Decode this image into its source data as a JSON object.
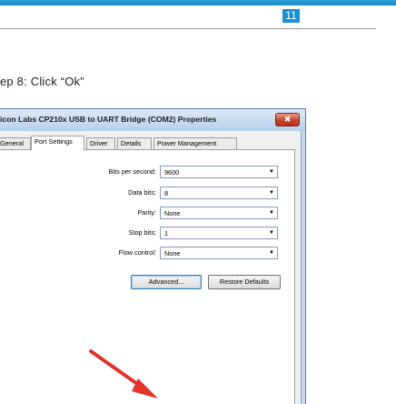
{
  "page": {
    "page_number": "11",
    "step_text": "ep 8: Click “Ok”"
  },
  "dialog": {
    "title": "icon Labs CP210x USB to UART Bridge (COM2) Properties",
    "close_glyph": "✖",
    "tabs": [
      {
        "label": "General",
        "active": false
      },
      {
        "label": "Port Settings",
        "active": true
      },
      {
        "label": "Driver",
        "active": false
      },
      {
        "label": "Details",
        "active": false
      },
      {
        "label": "Power Management",
        "active": false
      }
    ],
    "fields": [
      {
        "label": "Bits per second:",
        "value": "9600"
      },
      {
        "label": "Data bits:",
        "value": "8"
      },
      {
        "label": "Parity:",
        "value": "None"
      },
      {
        "label": "Stop bits:",
        "value": "1"
      },
      {
        "label": "Flow control:",
        "value": "None"
      }
    ],
    "buttons": {
      "advanced": "Advanced...",
      "restore": "Restore Defaults"
    },
    "dropdown_glyph": "▼"
  },
  "annotation": {
    "arrow_color": "#e2322c"
  }
}
